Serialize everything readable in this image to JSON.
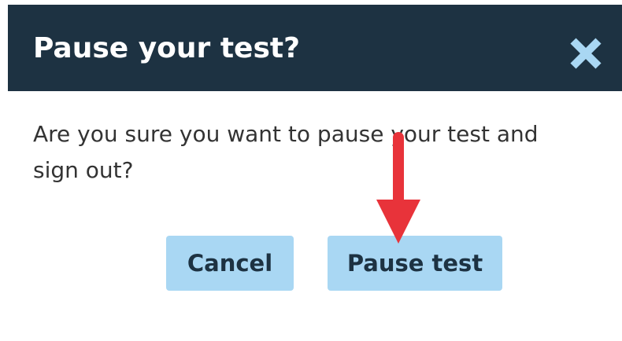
{
  "dialog": {
    "title": "Pause your test?",
    "close_icon": "close-icon",
    "message": "Are you sure you want to pause your test and sign out?",
    "buttons": {
      "cancel_label": "Cancel",
      "pause_label": "Pause test"
    }
  },
  "annotation": {
    "arrow_icon": "arrow-down-icon",
    "arrow_color": "#e8333a"
  },
  "colors": {
    "header_bg": "#1d3242",
    "button_bg": "#a9d7f3",
    "button_text": "#1d3242",
    "close_icon": "#a9d7f3"
  }
}
